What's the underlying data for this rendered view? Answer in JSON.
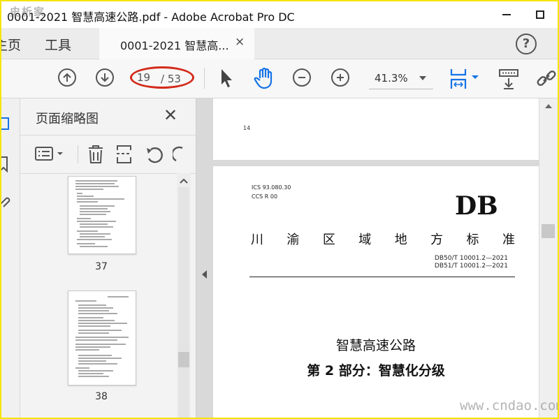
{
  "window": {
    "title": "0001-2021 智慧高速公路.pdf - Adobe Acrobat Pro DC",
    "watermark_top": "史析家"
  },
  "tabbar": {
    "home_label": "主页",
    "tools_label": "工具",
    "document_tab_label": "0001-2021 智慧高...",
    "close_glyph": "×",
    "help_glyph": "?"
  },
  "toolbar": {
    "current_page": "19",
    "total_pages": "/ 53",
    "zoom": "41.3%"
  },
  "panel": {
    "title": "页面缩略图",
    "close_glyph": "✕",
    "thumbnails": [
      {
        "label": "37"
      },
      {
        "label": "38"
      }
    ]
  },
  "document": {
    "prev_page_number": "14",
    "ics_line1": "ICS 93.080.30",
    "ics_line2": "CCS R 00",
    "db_mark": "DB",
    "standard_title_chars": [
      "川",
      "渝",
      "区",
      "域",
      "地",
      "方",
      "标",
      "准"
    ],
    "code1": "DB50/T 10001.2—2021",
    "code2": "DB51/T 10001.2—2021",
    "title_line1": "智慧高速公路",
    "title_line2": "第 2 部分：智慧化分级"
  },
  "watermark_bottom": "www.cndao.com",
  "colors": {
    "frame": "#f5e400",
    "accent_blue": "#1473e6",
    "highlight_red": "#d42a1a"
  }
}
